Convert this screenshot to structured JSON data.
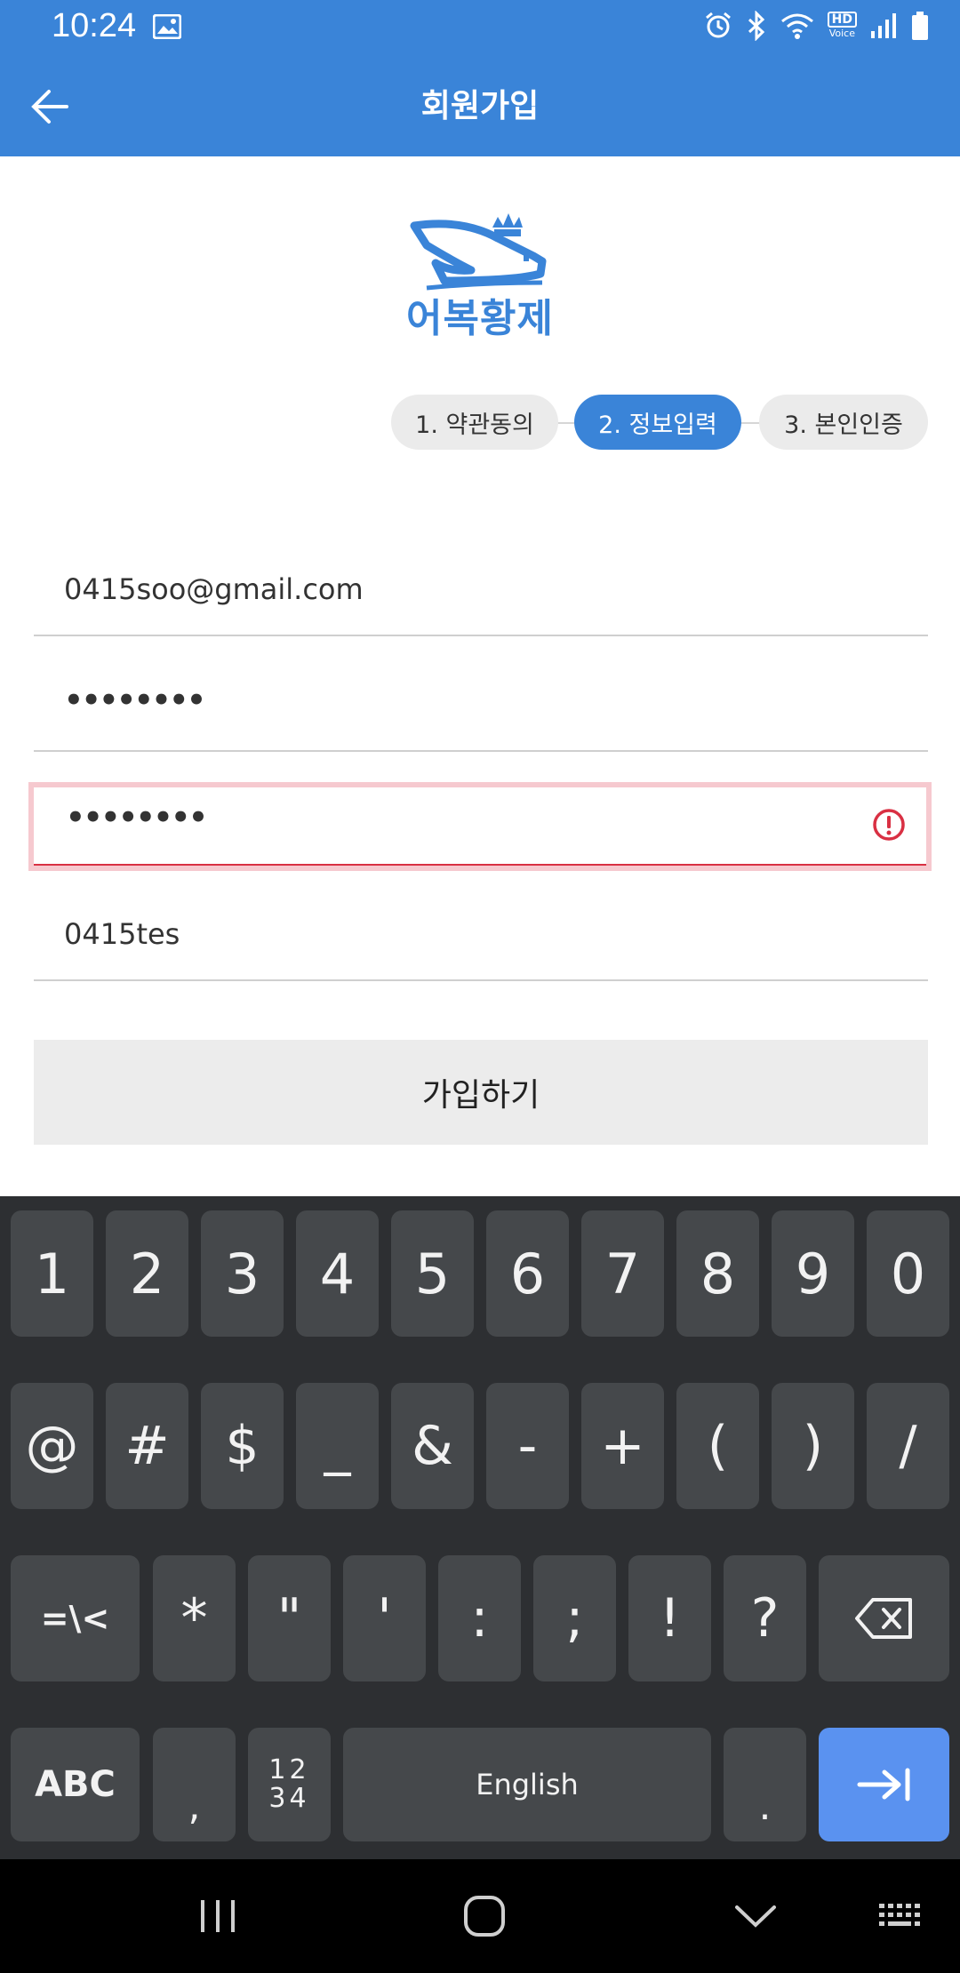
{
  "status": {
    "time": "10:24",
    "hd_label": "HD",
    "voice_label": "Voice"
  },
  "appbar": {
    "title": "회원가입"
  },
  "logo": {
    "text": "어복황제"
  },
  "steps": [
    {
      "label": "1. 약관동의",
      "active": false
    },
    {
      "label": "2. 정보입력",
      "active": true
    },
    {
      "label": "3. 본인인증",
      "active": false
    }
  ],
  "form": {
    "email": "0415soo@gmail.com",
    "password_mask": "••••••••",
    "password_confirm_mask": "••••••••",
    "nickname": "0415tes",
    "submit_label": "가입하기"
  },
  "keyboard": {
    "row1": [
      "1",
      "2",
      "3",
      "4",
      "5",
      "6",
      "7",
      "8",
      "9",
      "0"
    ],
    "row2": [
      "@",
      "#",
      "$",
      "_",
      "&",
      "-",
      "+",
      "(",
      ")",
      "/"
    ],
    "row3": [
      "=\\<",
      "*",
      "\"",
      "'",
      ":",
      ";",
      "!",
      "?"
    ],
    "abc": "ABC",
    "comma": ",",
    "numpad_top": "12",
    "numpad_bottom": "34",
    "space": "English",
    "period": "."
  },
  "colors": {
    "primary": "#3a84d8",
    "error": "#d93043",
    "keyboard_bg": "#2d2f32",
    "enter": "#5a92f0"
  }
}
